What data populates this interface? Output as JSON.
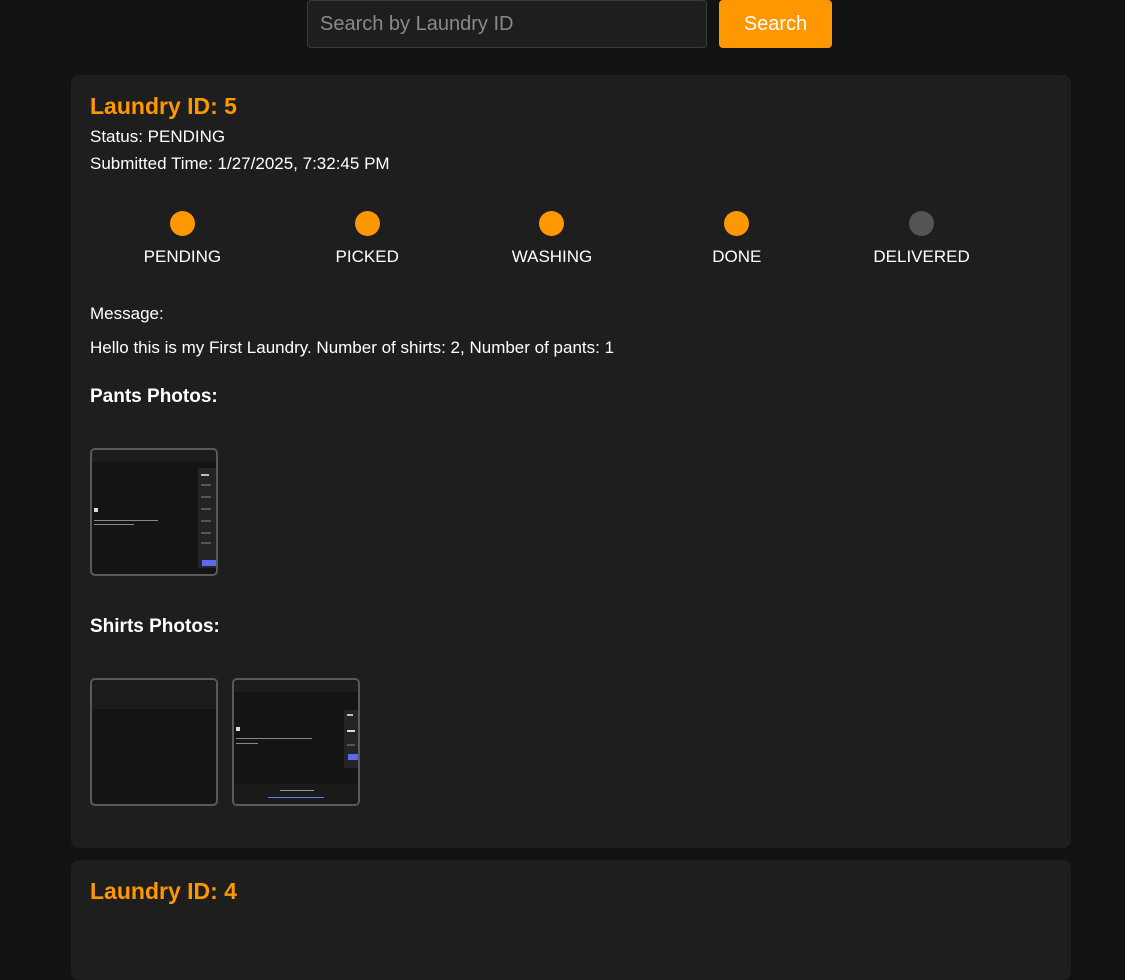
{
  "search": {
    "placeholder": "Search by Laundry ID",
    "value": "",
    "button_label": "Search"
  },
  "colors": {
    "accent": "#ff9800",
    "inactive_dot": "#555555",
    "card_bg": "#1e1e1e",
    "page_bg": "#121212"
  },
  "laundries": [
    {
      "title": "Laundry ID: 5",
      "status_text": "Status: PENDING",
      "submitted_text": "Submitted Time: 1/27/2025, 7:32:45 PM",
      "timeline": [
        {
          "label": "PENDING",
          "active": true
        },
        {
          "label": "PICKED",
          "active": true
        },
        {
          "label": "WASHING",
          "active": true
        },
        {
          "label": "DONE",
          "active": true
        },
        {
          "label": "DELIVERED",
          "active": false
        }
      ],
      "message_label": "Message:",
      "message": "Hello this is my First Laundry. Number of shirts: 2, Number of pants: 1",
      "pants_heading": "Pants Photos:",
      "pants_photo_count": 1,
      "shirts_heading": "Shirts Photos:",
      "shirts_photo_count": 2
    },
    {
      "title": "Laundry ID: 4"
    }
  ]
}
